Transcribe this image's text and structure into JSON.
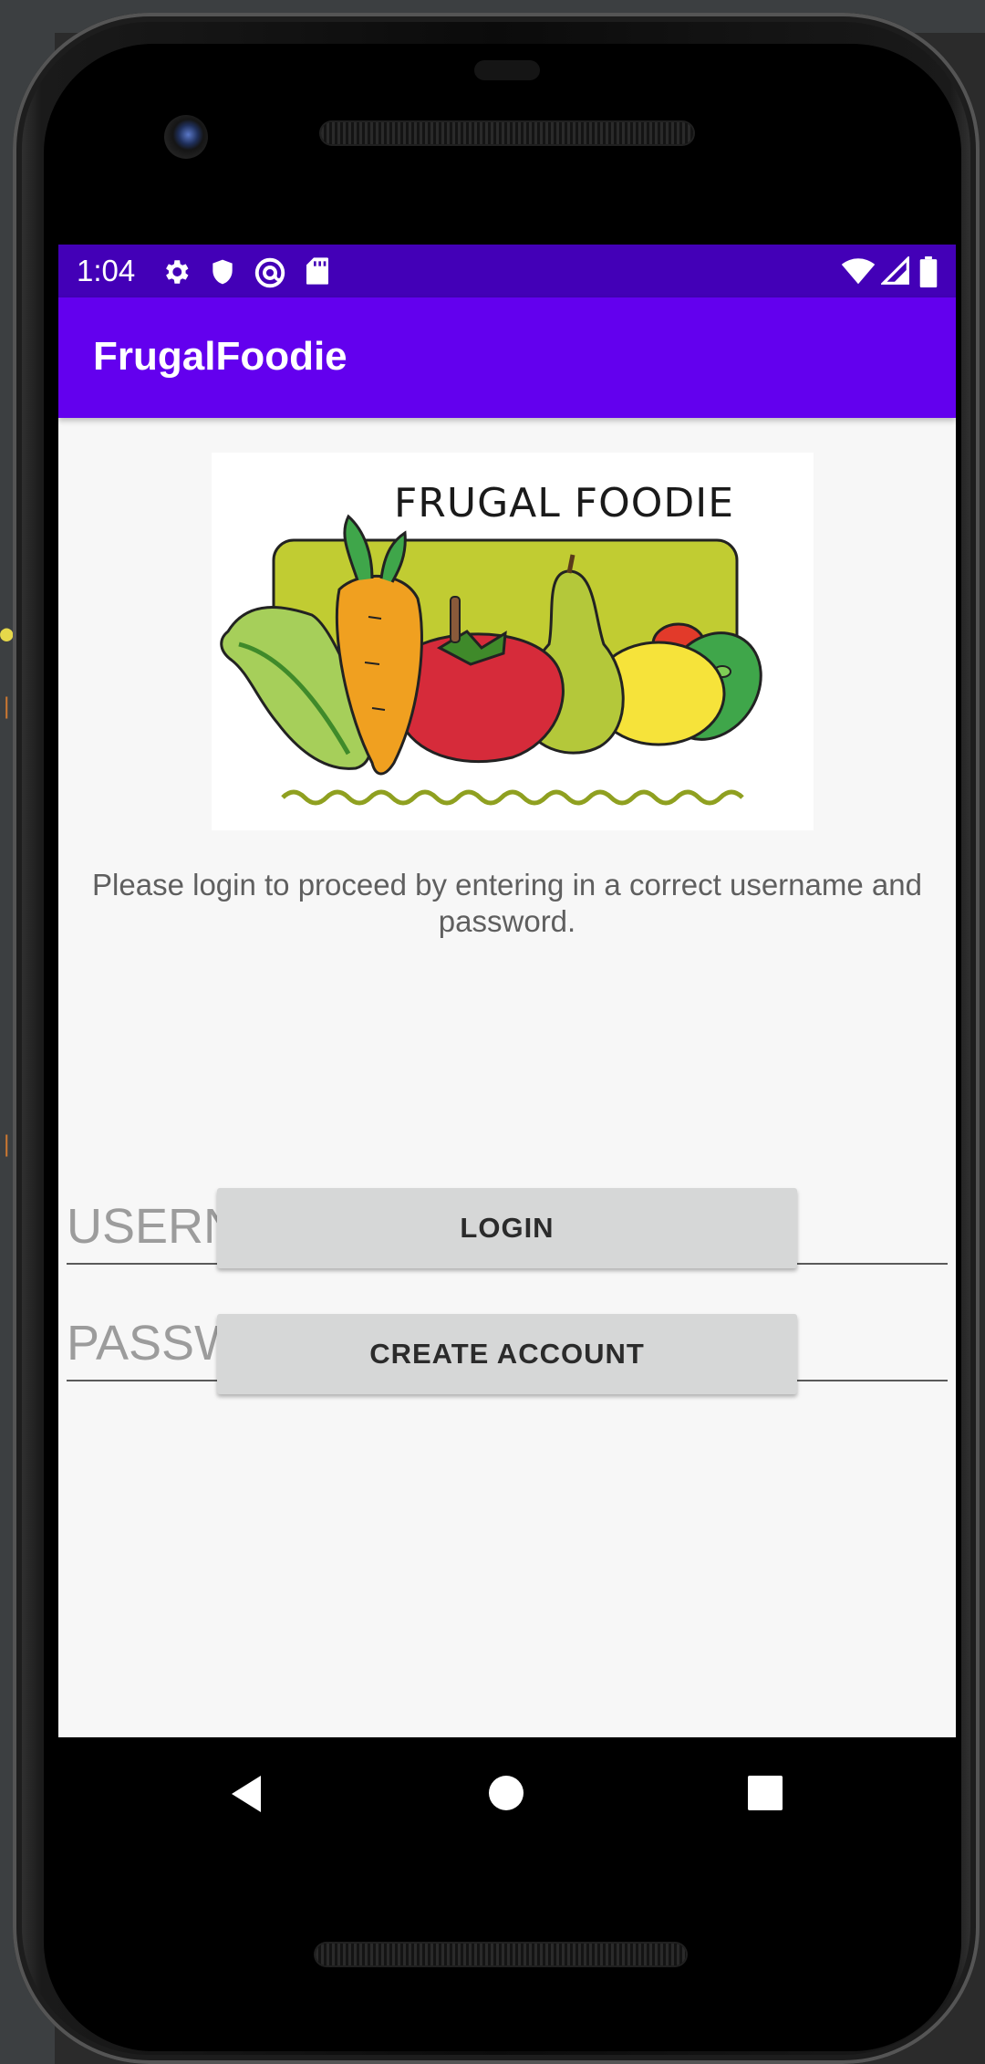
{
  "status_bar": {
    "time": "1:04",
    "left_icons": [
      "gear-icon",
      "shield-icon",
      "at-sign-icon",
      "sd-card-icon"
    ],
    "right_icons": [
      "wifi-icon",
      "signal-icon",
      "battery-icon"
    ],
    "background_color": "#4300b7"
  },
  "app_bar": {
    "title": "FrugalFoodie",
    "background_color": "#6300ee"
  },
  "logo": {
    "text": "FRUGAL FOODIE"
  },
  "login": {
    "instructions": "Please login to proceed by entering in a correct username and password.",
    "username_placeholder": "USERNAME",
    "username_value": "",
    "password_placeholder": "PASSWORD",
    "password_value": "",
    "login_label": "LOGIN",
    "create_account_label": "CREATE ACCOUNT"
  },
  "navigation": {
    "buttons": [
      "back-icon",
      "home-icon",
      "recents-icon"
    ]
  }
}
